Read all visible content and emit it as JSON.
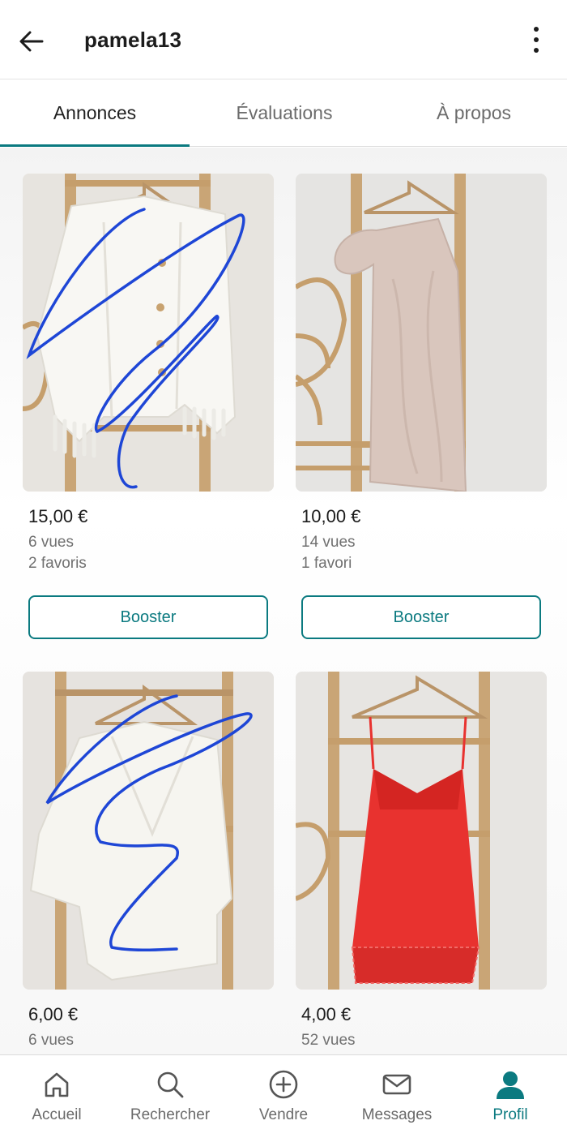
{
  "header": {
    "title": "pamela13",
    "back_icon": "arrow-left-icon",
    "menu_icon": "more-vertical-icon"
  },
  "tabs": [
    {
      "label": "Annonces",
      "active": true
    },
    {
      "label": "Évaluations",
      "active": false
    },
    {
      "label": "À propos",
      "active": false
    }
  ],
  "listings": [
    {
      "price": "15,00 €",
      "views": "6 vues",
      "favorites": "2 favoris",
      "button": "Booster",
      "item": "white-knit-cardigan"
    },
    {
      "price": "10,00 €",
      "views": "14 vues",
      "favorites": "1 favori",
      "button": "Booster",
      "item": "beige-one-shoulder-dress"
    },
    {
      "price": "6,00 €",
      "views": "6 vues",
      "item": "white-sheer-blouse"
    },
    {
      "price": "4,00 €",
      "views": "52 vues",
      "item": "red-lace-slip-dress"
    }
  ],
  "bottom_nav": [
    {
      "label": "Accueil",
      "icon": "home-icon",
      "active": false
    },
    {
      "label": "Rechercher",
      "icon": "search-icon",
      "active": false
    },
    {
      "label": "Vendre",
      "icon": "plus-circle-icon",
      "active": false
    },
    {
      "label": "Messages",
      "icon": "mail-icon",
      "active": false
    },
    {
      "label": "Profil",
      "icon": "profile-icon",
      "active": true
    }
  ],
  "colors": {
    "accent": "#0b7a80",
    "text": "#1f1f1f",
    "muted": "#707070",
    "scribble": "#1e46d6",
    "red_dress": "#e8322f"
  }
}
